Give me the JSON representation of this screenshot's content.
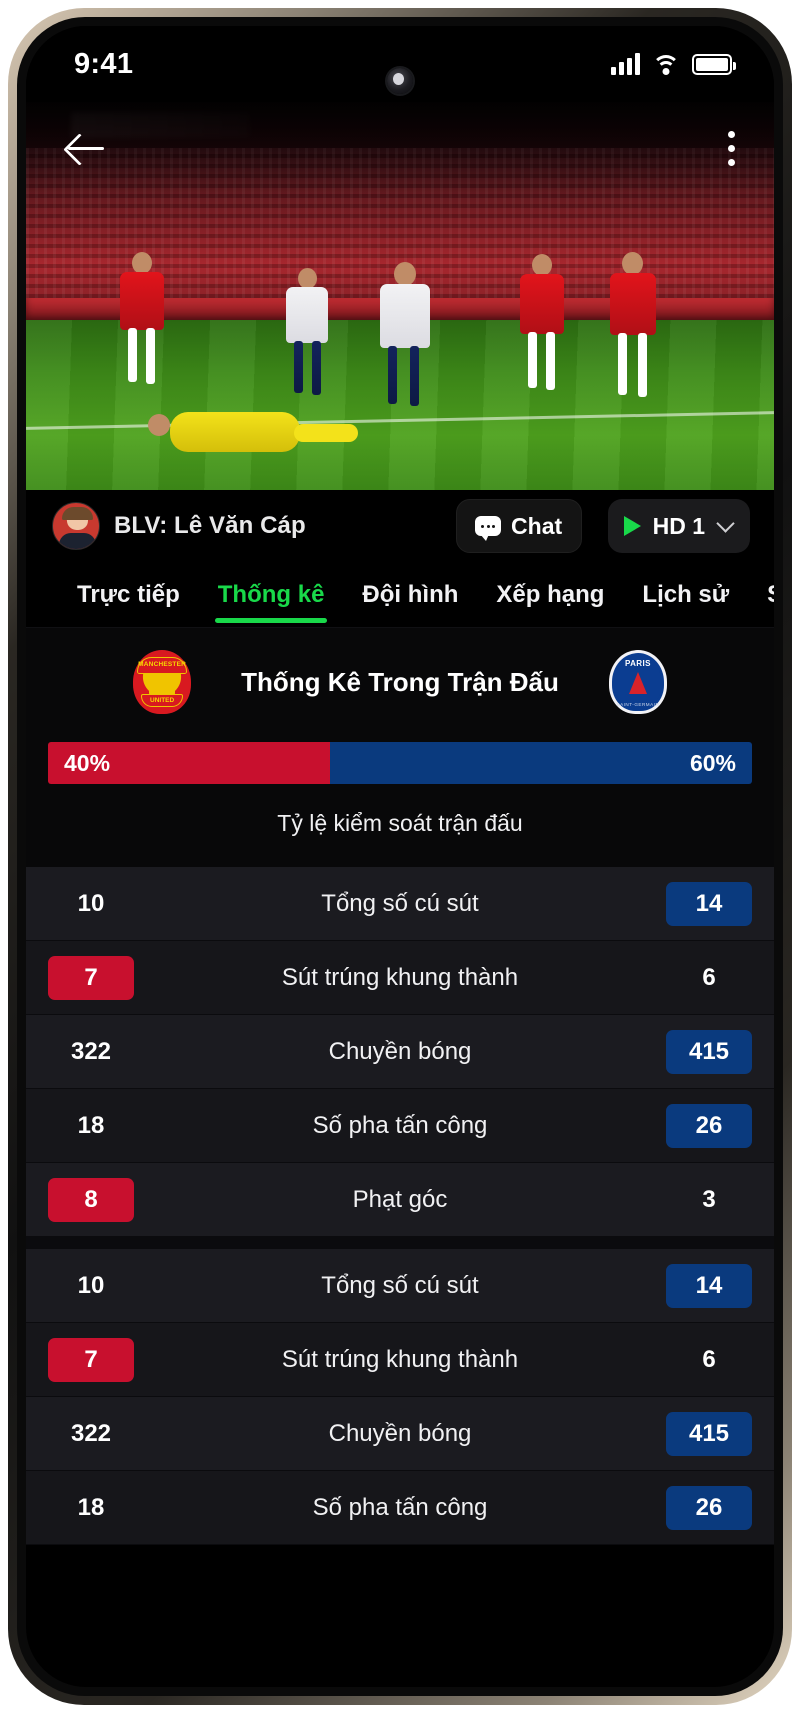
{
  "status_bar": {
    "time": "9:41",
    "signal_icon": "signal-bars-icon",
    "wifi_icon": "wifi-icon",
    "battery_icon": "battery-full-icon"
  },
  "video": {
    "back_icon": "back-arrow-icon",
    "menu_icon": "kebab-menu-icon"
  },
  "commentator": {
    "avatar": "commentator-avatar",
    "name": "BLV: Lê Văn Cáp",
    "chat_label": "Chat",
    "chat_icon": "chat-bubble-icon",
    "quality_label": "HD 1",
    "play_icon": "play-triangle-icon",
    "chevron_icon": "chevron-down-icon"
  },
  "tabs": [
    {
      "label": "Trực tiếp",
      "active": false
    },
    {
      "label": "Thống kê",
      "active": true
    },
    {
      "label": "Đội hình",
      "active": false
    },
    {
      "label": "Xếp hạng",
      "active": false
    },
    {
      "label": "Lịch sử",
      "active": false
    },
    {
      "label": "Soi",
      "active": false
    }
  ],
  "stats_header": {
    "home_crest": "manchester-united-crest",
    "away_crest": "paris-saint-germain-crest",
    "title": "Thống Kê Trong Trận Đấu"
  },
  "possession": {
    "home_pct_label": "40%",
    "away_pct_label": "60%",
    "home_pct": 40,
    "away_pct": 60,
    "caption": "Tỷ lệ kiểm soát trận đấu",
    "home_color": "#C8102E",
    "away_color": "#0A3A7E"
  },
  "chart_data": {
    "type": "bar",
    "title": "Thống Kê Trong Trận Đấu",
    "categories": [
      "Tỷ lệ kiểm soát trận đấu",
      "Tổng số cú sút",
      "Sút trúng khung thành",
      "Chuyền bóng",
      "Số pha tấn công",
      "Phạt góc"
    ],
    "series": [
      {
        "name": "Manchester United",
        "color": "#C8102E",
        "values": [
          40,
          10,
          7,
          322,
          18,
          8
        ]
      },
      {
        "name": "Paris Saint-Germain",
        "color": "#0A3A7E",
        "values": [
          60,
          14,
          6,
          415,
          26,
          3
        ]
      }
    ],
    "legend": "none",
    "grid": false
  },
  "stat_rows": [
    {
      "home": "10",
      "label": "Tổng số cú sút",
      "away": "14",
      "home_highlight": false,
      "away_highlight": true
    },
    {
      "home": "7",
      "label": "Sút trúng khung thành",
      "away": "6",
      "home_highlight": true,
      "away_highlight": false
    },
    {
      "home": "322",
      "label": "Chuyền bóng",
      "away": "415",
      "home_highlight": false,
      "away_highlight": true
    },
    {
      "home": "18",
      "label": "Số pha tấn công",
      "away": "26",
      "home_highlight": false,
      "away_highlight": true
    },
    {
      "home": "8",
      "label": "Phạt góc",
      "away": "3",
      "home_highlight": true,
      "away_highlight": false
    }
  ],
  "stat_rows_repeat": [
    {
      "home": "10",
      "label": "Tổng số cú sút",
      "away": "14",
      "home_highlight": false,
      "away_highlight": true
    },
    {
      "home": "7",
      "label": "Sút trúng khung thành",
      "away": "6",
      "home_highlight": true,
      "away_highlight": false
    },
    {
      "home": "322",
      "label": "Chuyền bóng",
      "away": "415",
      "home_highlight": false,
      "away_highlight": true
    },
    {
      "home": "18",
      "label": "Số pha tấn công",
      "away": "26",
      "home_highlight": false,
      "away_highlight": true
    }
  ]
}
